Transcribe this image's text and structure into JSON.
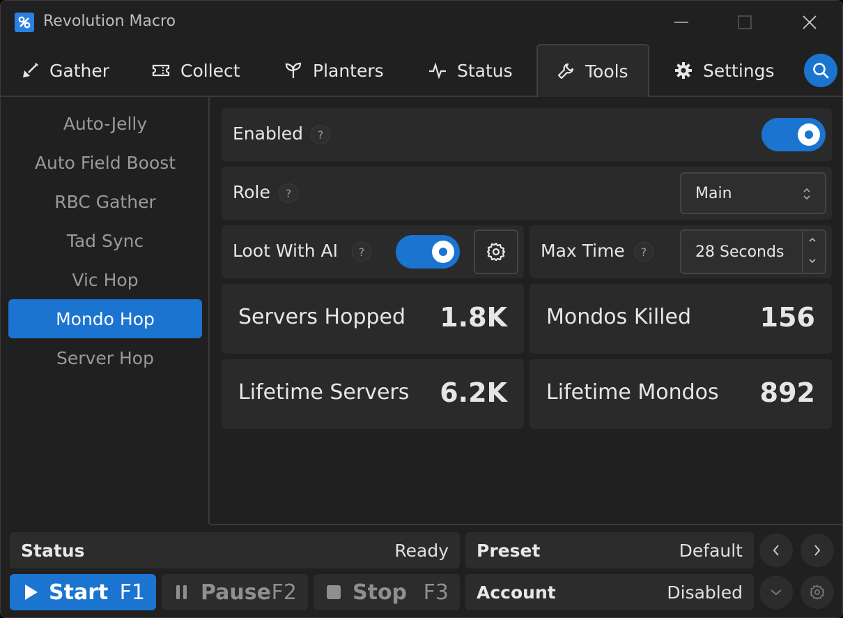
{
  "window": {
    "title": "Revolution Macro"
  },
  "tabs": [
    {
      "label": "Gather",
      "icon": "shovel-icon"
    },
    {
      "label": "Collect",
      "icon": "ticket-icon"
    },
    {
      "label": "Planters",
      "icon": "sprout-icon"
    },
    {
      "label": "Status",
      "icon": "activity-icon"
    },
    {
      "label": "Tools",
      "icon": "wrench-icon",
      "active": true
    },
    {
      "label": "Settings",
      "icon": "gear-icon"
    }
  ],
  "sidebar": {
    "items": [
      "Auto-Jelly",
      "Auto Field Boost",
      "RBC Gather",
      "Tad Sync",
      "Vic Hop",
      "Mondo Hop",
      "Server Hop"
    ],
    "active": "Mondo Hop"
  },
  "main": {
    "enabled": {
      "label": "Enabled",
      "help": "?",
      "on": true
    },
    "role": {
      "label": "Role",
      "help": "?",
      "value": "Main"
    },
    "loot": {
      "label": "Loot With AI",
      "help": "?",
      "on": true
    },
    "max_time": {
      "label": "Max Time",
      "help": "?",
      "value": "28 Seconds"
    },
    "stats": {
      "servers_hopped": {
        "label": "Servers Hopped",
        "value": "1.8K"
      },
      "mondos_killed": {
        "label": "Mondos Killed",
        "value": "156"
      },
      "lifetime_servers": {
        "label": "Lifetime Servers",
        "value": "6.2K"
      },
      "lifetime_mondos": {
        "label": "Lifetime Mondos",
        "value": "892"
      }
    }
  },
  "bottom": {
    "status": {
      "label": "Status",
      "value": "Ready"
    },
    "preset": {
      "label": "Preset",
      "value": "Default"
    },
    "account": {
      "label": "Account",
      "value": "Disabled"
    },
    "start": {
      "label": "Start",
      "key": "F1"
    },
    "pause": {
      "label": "Pause",
      "key": "F2"
    },
    "stop": {
      "label": "Stop",
      "key": "F3"
    }
  },
  "colors": {
    "accent": "#1b74d0",
    "background": "#202020",
    "panel": "#2a2a2a"
  }
}
